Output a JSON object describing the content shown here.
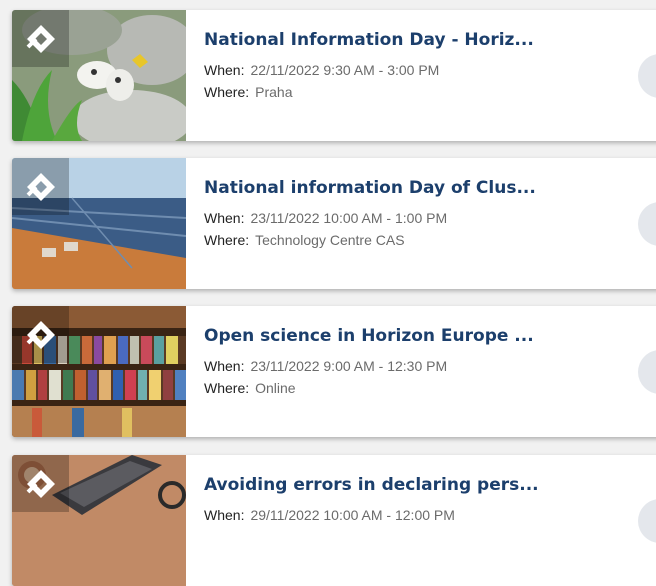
{
  "labels": {
    "when": "When:",
    "where": "Where:"
  },
  "events": [
    {
      "title": "National Information Day - Horiz...",
      "when": "22/11/2022 9:30 AM - 3:00 PM",
      "where": "Praha",
      "image": "butterfly-on-flower-photo"
    },
    {
      "title": "National information Day of Clus...",
      "when": "23/11/2022 10:00 AM - 1:00 PM",
      "where": "Technology Centre CAS",
      "image": "solar-panel-field-photo"
    },
    {
      "title": "Open science in Horizon Europe ...",
      "when": "23/11/2022 9:00 AM - 12:30 PM",
      "where": "Online",
      "image": "library-bookshelves-photo"
    },
    {
      "title": "Avoiding errors in declaring pers...",
      "when": "29/11/2022 10:00 AM - 12:00 PM",
      "where": "",
      "image": "laptop-on-desk-photo"
    }
  ],
  "colors": {
    "title": "#1c3f6c",
    "card": "#ffffff",
    "background": "#f1f1f1"
  }
}
